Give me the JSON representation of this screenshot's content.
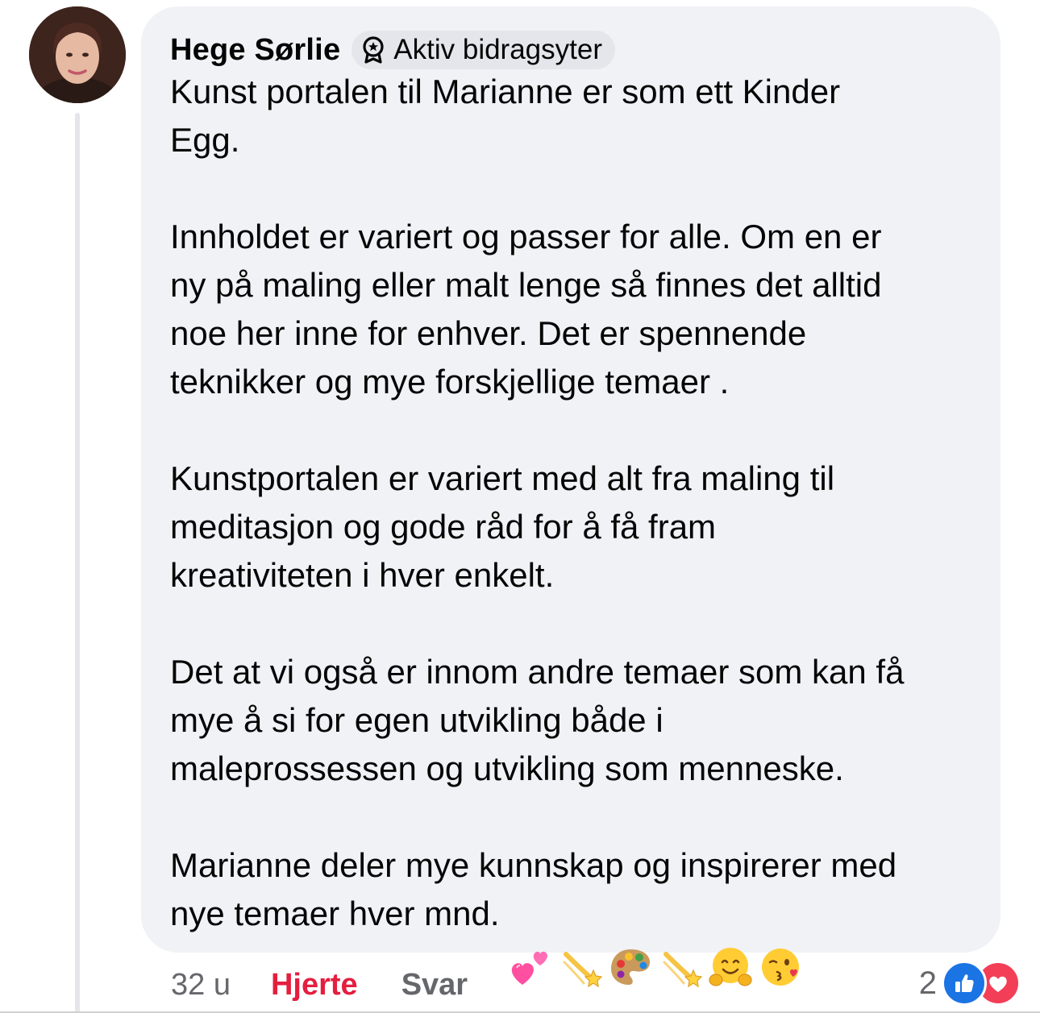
{
  "comment": {
    "author": "Hege Sørlie",
    "badge": "Aktiv bidragsyter",
    "paragraphs": [
      "Kunst portalen til Marianne er som ett Kinder\nEgg.",
      "Innholdet er variert og passer for alle.  Om en er\nny på maling eller malt lenge så finnes det alltid\nnoe her inne for enhver. Det er spennende\nteknikker og mye forskjellige temaer .",
      "Kunstportalen er variert med alt fra maling til\nmeditasjon og gode råd for å få fram\nkreativiteten i hver enkelt.",
      "Det at vi også er innom andre temaer som kan få\nmye å si for egen utvikling både i\nmaleprossessen og utvikling som menneske.",
      "Marianne deler mye kunnskap og inspirerer med\nnye temaer hver mnd."
    ],
    "emojis": [
      "two-hearts-icon",
      "dizzy-star-icon",
      "artist-palette-icon",
      "dizzy-star-icon",
      "hugging-face-icon",
      "kissing-face-icon"
    ]
  },
  "actions": {
    "time": "32 u",
    "heart": "Hjerte",
    "reply": "Svar"
  },
  "reactions": {
    "count": "2",
    "types": [
      "like-icon",
      "love-icon"
    ]
  },
  "colors": {
    "bubble": "#f0f2f5",
    "heart_action": "#e41e3f",
    "like": "#1b74e4",
    "love": "#f33e58",
    "muted": "#65676b"
  }
}
